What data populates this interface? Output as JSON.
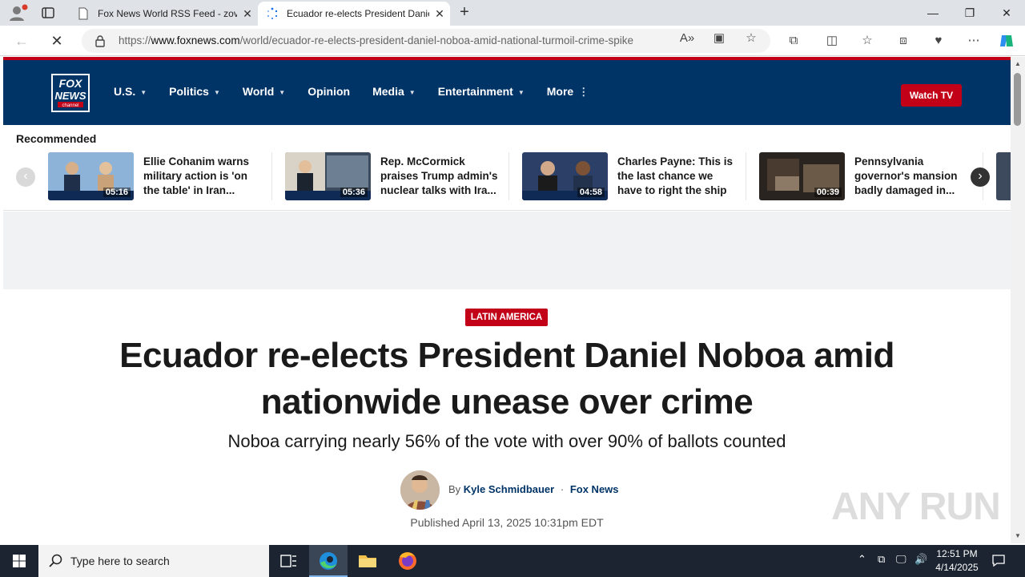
{
  "browser": {
    "tabs": [
      {
        "title": "Fox News World RSS Feed - zovel",
        "active": false
      },
      {
        "title": "Ecuador re-elects President Danie",
        "active": true
      }
    ],
    "url_prefix": "https://",
    "url_domain": "www.foxnews.com",
    "url_path": "/world/ecuador-re-elects-president-daniel-noboa-amid-national-turmoil-crime-spike",
    "window_controls": {
      "minimize": "—",
      "maximize": "❐",
      "close": "✕"
    }
  },
  "site": {
    "logo_text": [
      "FOX",
      "NEWS",
      "channel"
    ],
    "nav": [
      {
        "label": "U.S.",
        "caret": "▼"
      },
      {
        "label": "Politics",
        "caret": "▼"
      },
      {
        "label": "World",
        "caret": "▼"
      },
      {
        "label": "Opinion",
        "caret": ""
      },
      {
        "label": "Media",
        "caret": "▼"
      },
      {
        "label": "Entertainment",
        "caret": "▼"
      },
      {
        "label": "More",
        "caret": "⋮"
      }
    ],
    "watch_tv": "Watch TV",
    "brand_red": "#c20017",
    "brand_navy": "#003366"
  },
  "recommended": {
    "title": "Recommended",
    "items": [
      {
        "duration": "05:16",
        "headline": "Ellie Cohanim warns military action is 'on the table' in Iran..."
      },
      {
        "duration": "05:36",
        "headline": "Rep. McCormick praises Trump admin's nuclear talks with Ira..."
      },
      {
        "duration": "04:58",
        "headline": "Charles Payne: This is the last chance we have to right the ship"
      },
      {
        "duration": "00:39",
        "headline": "Pennsylvania governor's mansion badly damaged in..."
      }
    ]
  },
  "article": {
    "eyebrow": "LATIN AMERICA",
    "headline": "Ecuador re-elects President Daniel Noboa amid nationwide unease over crime",
    "subhead": "Noboa carrying nearly 56% of the vote with over 90% of ballots counted",
    "by": "By",
    "author": "Kyle Schmidbauer",
    "separator": "·",
    "outlet": "Fox News",
    "published": "Published April 13, 2025 10:31pm EDT"
  },
  "watermark": "ANY RUN",
  "taskbar": {
    "search_placeholder": "Type here to search",
    "time": "12:51 PM",
    "date": "4/14/2025"
  }
}
